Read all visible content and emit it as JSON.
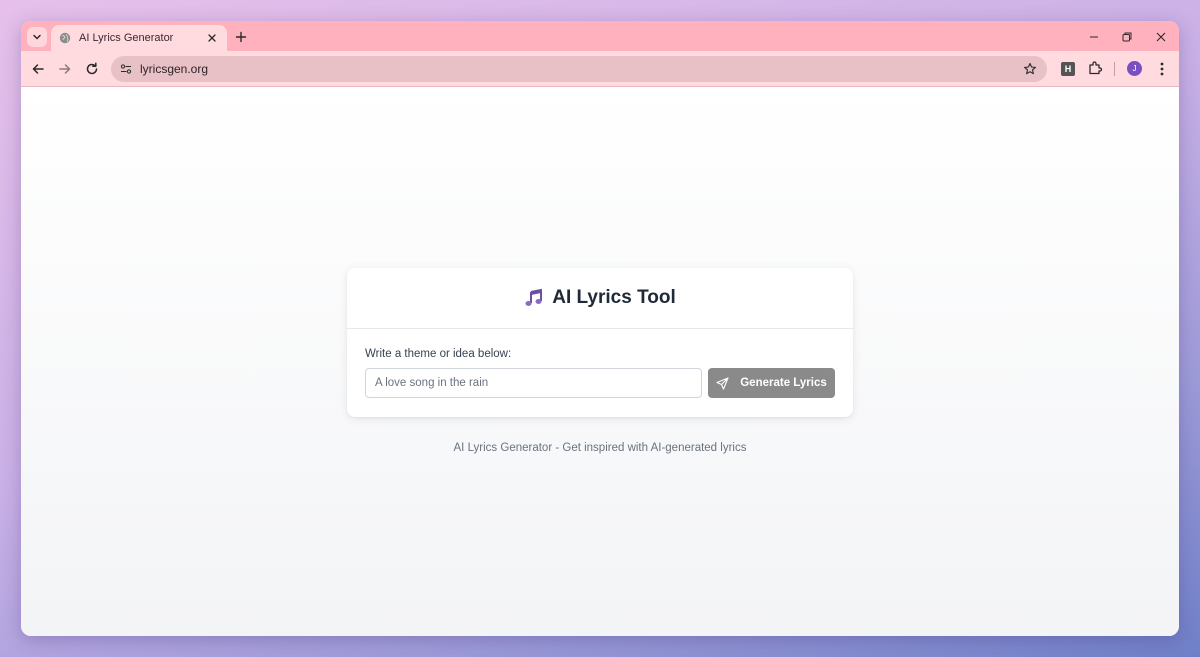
{
  "browser": {
    "tab": {
      "title": "AI Lyrics Generator",
      "favicon": "globe-icon"
    },
    "address_bar": {
      "url": "lyricsgen.org"
    },
    "extensions": {
      "h_label": "H"
    },
    "profile": {
      "initial": "J",
      "color": "#7a4fc2"
    },
    "colors": {
      "tab_strip": "#ffb2bd",
      "toolbar": "#ffdadf",
      "omnibox": "#e8c1c6"
    }
  },
  "card": {
    "title": "AI Lyrics Tool",
    "icon": "music-notes-icon",
    "prompt_label": "Write a theme or idea below:",
    "input": {
      "value": "",
      "placeholder": "A love song in the rain"
    },
    "button_label": "Generate Lyrics",
    "button_color": "#8a8a8a"
  },
  "footer": {
    "text": "AI Lyrics Generator - Get inspired with AI-generated lyrics"
  }
}
